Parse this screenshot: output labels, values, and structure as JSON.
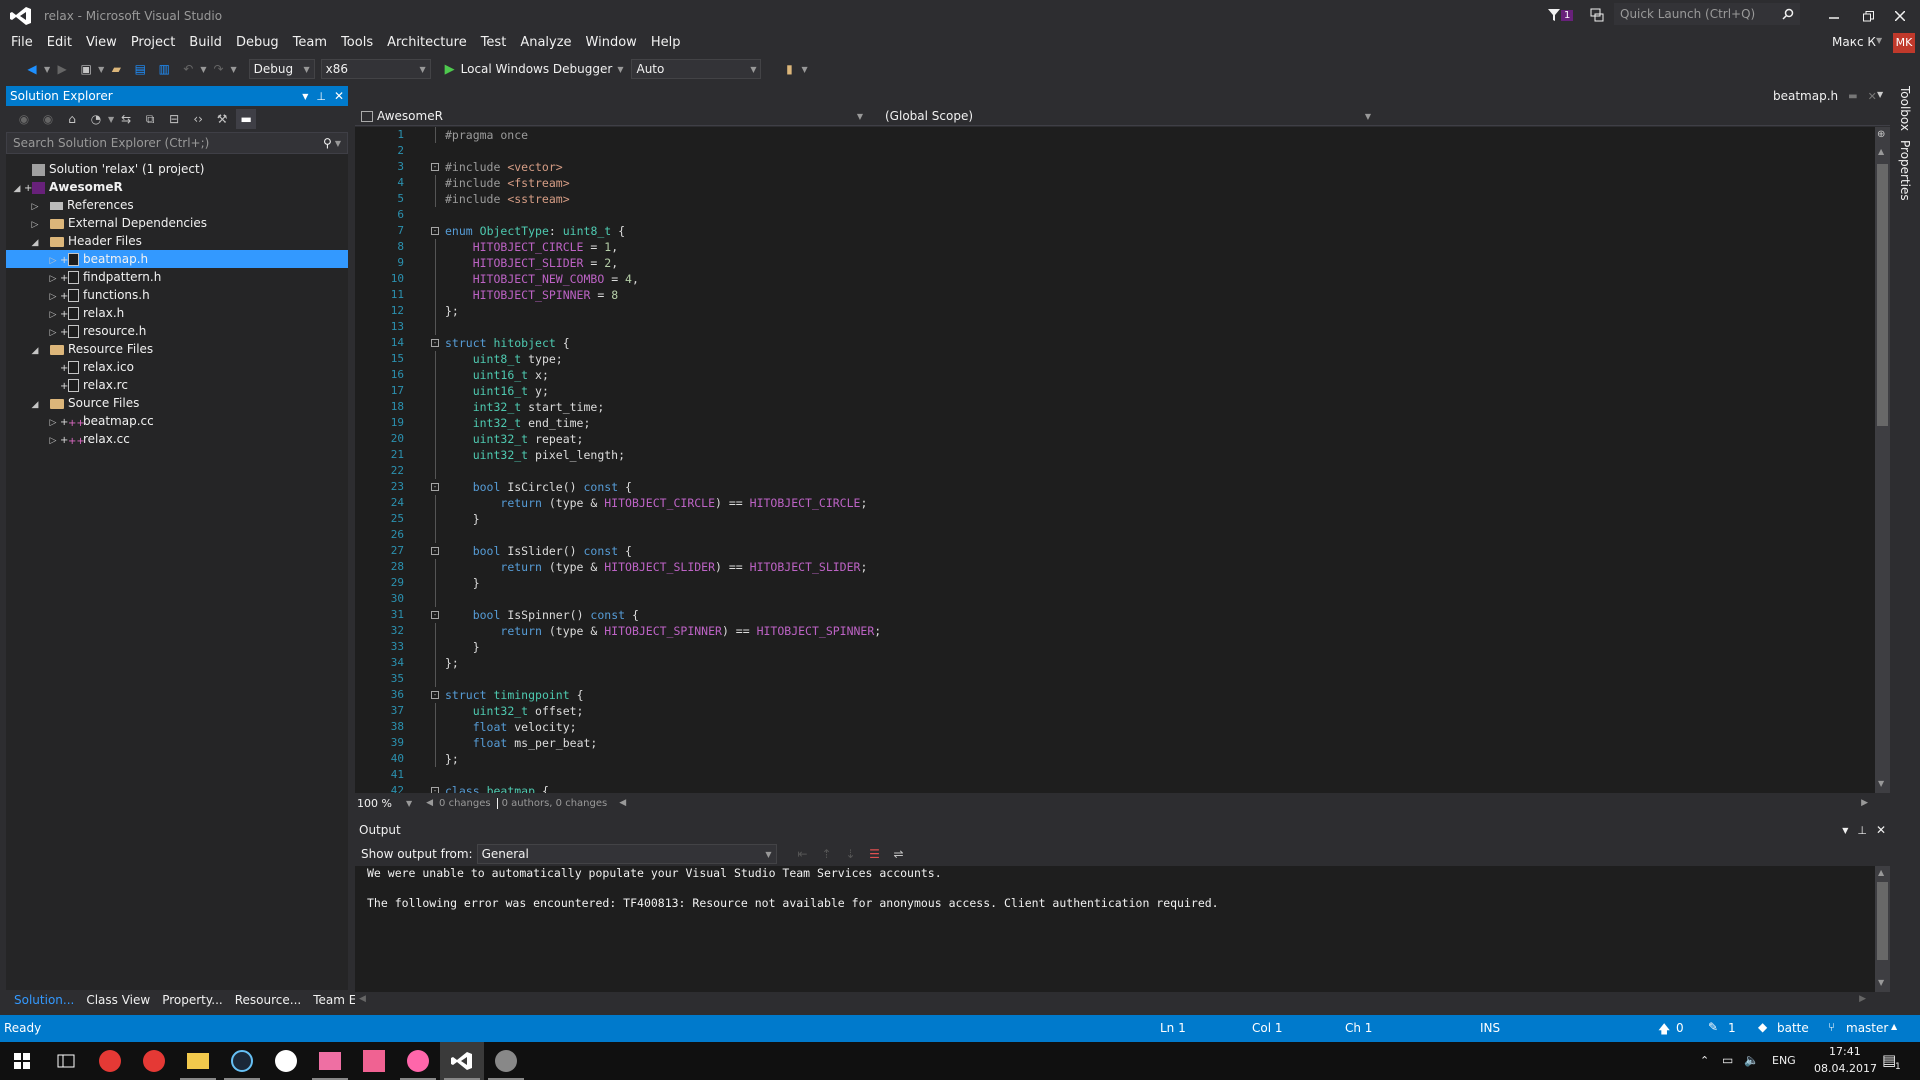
{
  "window": {
    "title": "relax - Microsoft Visual Studio",
    "notification_count": "1",
    "quick_launch_placeholder": "Quick Launch (Ctrl+Q)",
    "user_name": "Макс К",
    "user_initials": "MK"
  },
  "menu": [
    "File",
    "Edit",
    "View",
    "Project",
    "Build",
    "Debug",
    "Team",
    "Tools",
    "Architecture",
    "Test",
    "Analyze",
    "Window",
    "Help"
  ],
  "toolbar": {
    "configuration": "Debug",
    "platform": "x86",
    "debugger": "Local Windows Debugger",
    "debugger_mode": "Auto"
  },
  "solution_explorer": {
    "title": "Solution Explorer",
    "search_placeholder": "Search Solution Explorer (Ctrl+;)",
    "items": [
      {
        "label": "Solution 'relax' (1 project)",
        "level": 0,
        "arrow": "",
        "icon": "sol",
        "bold": false,
        "selected": false,
        "plus": false
      },
      {
        "label": "AwesomeR",
        "level": 0,
        "arrow": "▲",
        "icon": "proj",
        "bold": true,
        "selected": false,
        "plus": true
      },
      {
        "label": "References",
        "level": 1,
        "arrow": "▷",
        "icon": "ref",
        "bold": false,
        "selected": false,
        "plus": false
      },
      {
        "label": "External Dependencies",
        "level": 1,
        "arrow": "▷",
        "icon": "folder",
        "bold": false,
        "selected": false,
        "plus": false
      },
      {
        "label": "Header Files",
        "level": 1,
        "arrow": "◢",
        "icon": "folder",
        "bold": false,
        "selected": false,
        "plus": false
      },
      {
        "label": "beatmap.h",
        "level": 2,
        "arrow": "▷",
        "icon": "file",
        "bold": false,
        "selected": true,
        "plus": true
      },
      {
        "label": "findpattern.h",
        "level": 2,
        "arrow": "▷",
        "icon": "file",
        "bold": false,
        "selected": false,
        "plus": true
      },
      {
        "label": "functions.h",
        "level": 2,
        "arrow": "▷",
        "icon": "file",
        "bold": false,
        "selected": false,
        "plus": true
      },
      {
        "label": "relax.h",
        "level": 2,
        "arrow": "▷",
        "icon": "file",
        "bold": false,
        "selected": false,
        "plus": true
      },
      {
        "label": "resource.h",
        "level": 2,
        "arrow": "▷",
        "icon": "file",
        "bold": false,
        "selected": false,
        "plus": true
      },
      {
        "label": "Resource Files",
        "level": 1,
        "arrow": "◢",
        "icon": "folder",
        "bold": false,
        "selected": false,
        "plus": false
      },
      {
        "label": "relax.ico",
        "level": 2,
        "arrow": "",
        "icon": "file",
        "bold": false,
        "selected": false,
        "plus": true
      },
      {
        "label": "relax.rc",
        "level": 2,
        "arrow": "",
        "icon": "file",
        "bold": false,
        "selected": false,
        "plus": true
      },
      {
        "label": "Source Files",
        "level": 1,
        "arrow": "◢",
        "icon": "folder",
        "bold": false,
        "selected": false,
        "plus": false
      },
      {
        "label": "beatmap.cc",
        "level": 2,
        "arrow": "▷",
        "icon": "cc",
        "bold": false,
        "selected": false,
        "plus": true
      },
      {
        "label": "relax.cc",
        "level": 2,
        "arrow": "▷",
        "icon": "cc",
        "bold": false,
        "selected": false,
        "plus": true
      }
    ],
    "bottom_tabs": [
      "Solution...",
      "Class View",
      "Property...",
      "Resource...",
      "Team Exp..."
    ]
  },
  "editor": {
    "tab": "beatmap.h",
    "project_scope": "AwesomeR",
    "scope": "(Global Scope)",
    "zoom": "100 %",
    "changes": "0 changes",
    "authors": "0 authors, 0 changes",
    "lines": [
      "#pragma once",
      "",
      "#include <vector>",
      "#include <fstream>",
      "#include <sstream>",
      "",
      "enum ObjectType: uint8_t {",
      "    HITOBJECT_CIRCLE = 1,",
      "    HITOBJECT_SLIDER = 2,",
      "    HITOBJECT_NEW_COMBO = 4,",
      "    HITOBJECT_SPINNER = 8",
      "};",
      "",
      "struct hitobject {",
      "    uint8_t type;",
      "    uint16_t x;",
      "    uint16_t y;",
      "    int32_t start_time;",
      "    int32_t end_time;",
      "    uint32_t repeat;",
      "    uint32_t pixel_length;",
      "",
      "    bool IsCircle() const {",
      "        return (type & HITOBJECT_CIRCLE) == HITOBJECT_CIRCLE;",
      "    }",
      "",
      "    bool IsSlider() const {",
      "        return (type & HITOBJECT_SLIDER) == HITOBJECT_SLIDER;",
      "    }",
      "",
      "    bool IsSpinner() const {",
      "        return (type & HITOBJECT_SPINNER) == HITOBJECT_SPINNER;",
      "    }",
      "};",
      "",
      "struct timingpoint {",
      "    uint32_t offset;",
      "    float velocity;",
      "    float ms_per_beat;",
      "};",
      "",
      "class beatmap {"
    ]
  },
  "output": {
    "title": "Output",
    "show_from_label": "Show output from:",
    "source": "General",
    "lines": [
      "We were unable to automatically populate your Visual Studio Team Services accounts.",
      "",
      "The following error was encountered: TF400813: Resource not available for anonymous access. Client authentication required."
    ]
  },
  "right_strip": [
    "Toolbox",
    "Properties"
  ],
  "status": {
    "ready": "Ready",
    "ln": "Ln 1",
    "col": "Col 1",
    "ch": "Ch 1",
    "ins": "INS",
    "up_count": "0",
    "pencil_count": "1",
    "repo": "batte",
    "branch": "master"
  },
  "taskbar": {
    "lang": "ENG",
    "time": "17:41",
    "date": "08.04.2017",
    "notif_count": "1"
  }
}
